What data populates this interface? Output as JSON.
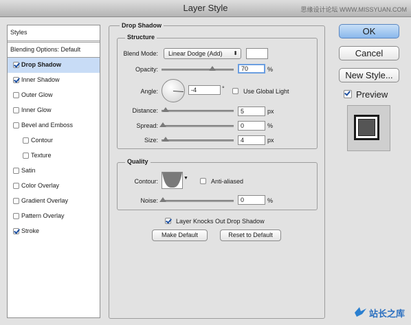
{
  "window": {
    "title": "Layer Style",
    "watermark": "思缘设计论坛 WWW.MISSYUAN.COM"
  },
  "styles_list": {
    "header": "Styles",
    "blending": "Blending Options: Default",
    "items": [
      {
        "label": "Drop Shadow",
        "checked": true,
        "selected": true,
        "indent": false
      },
      {
        "label": "Inner Shadow",
        "checked": true,
        "selected": false,
        "indent": false
      },
      {
        "label": "Outer Glow",
        "checked": false,
        "selected": false,
        "indent": false
      },
      {
        "label": "Inner Glow",
        "checked": false,
        "selected": false,
        "indent": false
      },
      {
        "label": "Bevel and Emboss",
        "checked": false,
        "selected": false,
        "indent": false
      },
      {
        "label": "Contour",
        "checked": false,
        "selected": false,
        "indent": true
      },
      {
        "label": "Texture",
        "checked": false,
        "selected": false,
        "indent": true
      },
      {
        "label": "Satin",
        "checked": false,
        "selected": false,
        "indent": false
      },
      {
        "label": "Color Overlay",
        "checked": false,
        "selected": false,
        "indent": false
      },
      {
        "label": "Gradient Overlay",
        "checked": false,
        "selected": false,
        "indent": false
      },
      {
        "label": "Pattern Overlay",
        "checked": false,
        "selected": false,
        "indent": false
      },
      {
        "label": "Stroke",
        "checked": true,
        "selected": false,
        "indent": false
      }
    ]
  },
  "drop_shadow": {
    "title": "Drop Shadow",
    "structure": {
      "title": "Structure",
      "blend_mode_label": "Blend Mode:",
      "blend_mode_value": "Linear Dodge (Add)",
      "blend_color": "#ffffff",
      "opacity_label": "Opacity:",
      "opacity_value": "70",
      "opacity_unit": "%",
      "opacity_level": 0.7,
      "angle_label": "Angle:",
      "angle_value": "-4",
      "angle_unit": "°",
      "use_global_light_label": "Use Global Light",
      "use_global_light": false,
      "distance_label": "Distance:",
      "distance_value": "5",
      "distance_unit": "px",
      "spread_label": "Spread:",
      "spread_value": "0",
      "spread_unit": "%",
      "size_label": "Size:",
      "size_value": "4",
      "size_unit": "px"
    },
    "quality": {
      "title": "Quality",
      "contour_label": "Contour:",
      "anti_aliased_label": "Anti-aliased",
      "anti_aliased": false,
      "noise_label": "Noise:",
      "noise_value": "0",
      "noise_unit": "%"
    },
    "knocks_out_label": "Layer Knocks Out Drop Shadow",
    "knocks_out": true,
    "make_default_label": "Make Default",
    "reset_default_label": "Reset to Default"
  },
  "buttons": {
    "ok": "OK",
    "cancel": "Cancel",
    "new_style": "New Style...",
    "preview": "Preview",
    "preview_checked": true
  },
  "logo": {
    "text": "站长之库"
  }
}
